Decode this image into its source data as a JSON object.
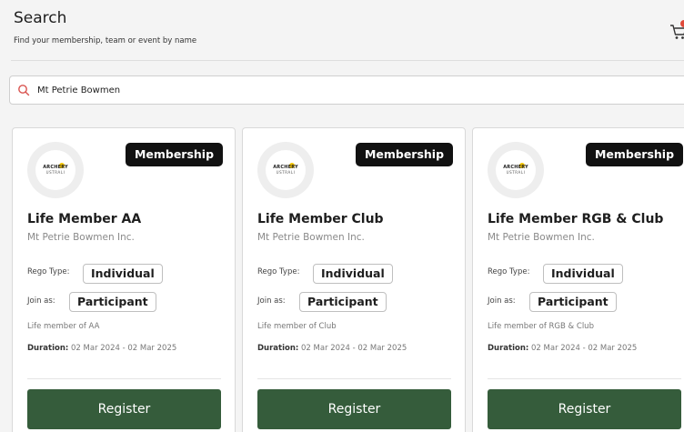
{
  "header": {
    "title": "Search",
    "subtitle": "Find your membership, team or event by name"
  },
  "search": {
    "value": "Mt Petrie Bowmen",
    "icon": "search-icon",
    "icon_color": "#d9534f"
  },
  "logo": {
    "text_top": "ARCHERY",
    "text_bottom": "USTRALI"
  },
  "cards": [
    {
      "badge": "Membership",
      "title": "Life Member AA",
      "org": "Mt Petrie Bowmen Inc.",
      "rego_label": "Rego Type:",
      "rego_value": "Individual",
      "join_label": "Join as:",
      "join_value": "Participant",
      "description": "Life member of AA",
      "duration_label": "Duration:",
      "duration_value": "02 Mar 2024 - 02 Mar 2025",
      "register_label": "Register"
    },
    {
      "badge": "Membership",
      "title": "Life Member Club",
      "org": "Mt Petrie Bowmen Inc.",
      "rego_label": "Rego Type:",
      "rego_value": "Individual",
      "join_label": "Join as:",
      "join_value": "Participant",
      "description": "Life member of Club",
      "duration_label": "Duration:",
      "duration_value": "02 Mar 2024 - 02 Mar 2025",
      "register_label": "Register"
    },
    {
      "badge": "Membership",
      "title": "Life Member RGB & Club",
      "org": "Mt Petrie Bowmen Inc.",
      "rego_label": "Rego Type:",
      "rego_value": "Individual",
      "join_label": "Join as:",
      "join_value": "Participant",
      "description": "Life member of RGB & Club",
      "duration_label": "Duration:",
      "duration_value": "02 Mar 2024 - 02 Mar 2025",
      "register_label": "Register"
    }
  ],
  "colors": {
    "register_bg": "#355c3b",
    "badge_bg": "#111111",
    "cart_badge": "#e04a3a"
  }
}
